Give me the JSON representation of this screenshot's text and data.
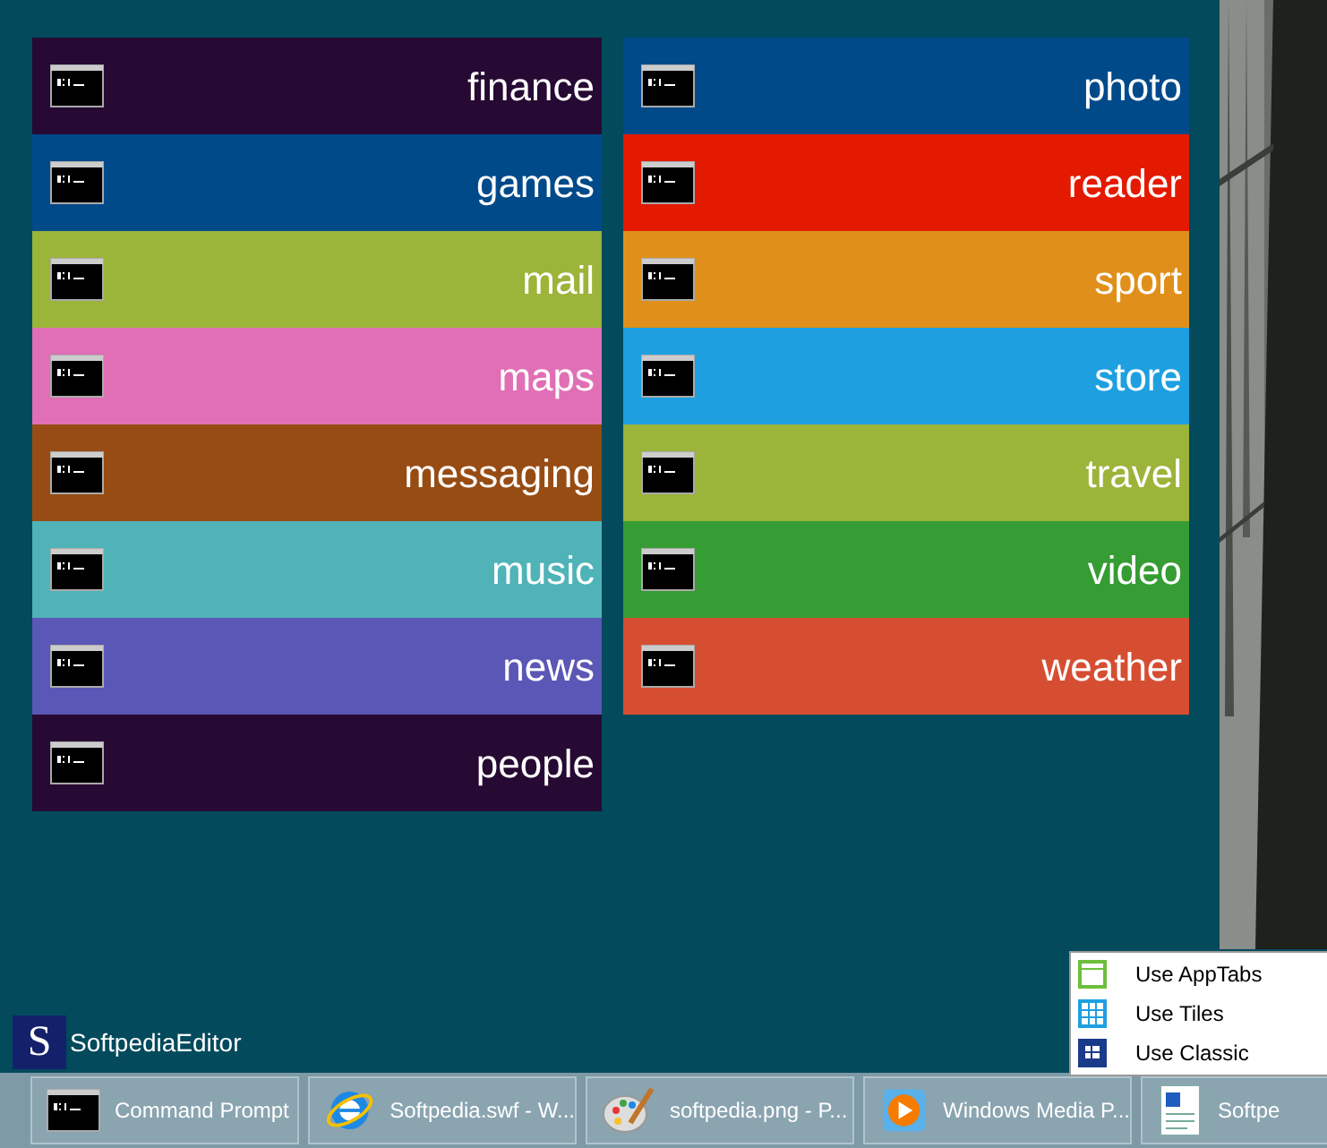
{
  "tiles_left": [
    {
      "label": "finance",
      "color": "#260a33"
    },
    {
      "label": "games",
      "color": "#004a8a"
    },
    {
      "label": "mail",
      "color": "#9bb43a"
    },
    {
      "label": "maps",
      "color": "#e16fb5"
    },
    {
      "label": "messaging",
      "color": "#974c14"
    },
    {
      "label": "music",
      "color": "#4fb3b8"
    },
    {
      "label": "news",
      "color": "#5b57b6"
    },
    {
      "label": "people",
      "color": "#260a33"
    }
  ],
  "tiles_right": [
    {
      "label": "photo",
      "color": "#004a8a"
    },
    {
      "label": "reader",
      "color": "#e41a00"
    },
    {
      "label": "sport",
      "color": "#e0901a"
    },
    {
      "label": "store",
      "color": "#1ea0e0"
    },
    {
      "label": "travel",
      "color": "#9bb43a"
    },
    {
      "label": "video",
      "color": "#369c34"
    },
    {
      "label": "weather",
      "color": "#d64e32"
    }
  ],
  "user": {
    "initial": "S",
    "name": "SoftpediaEditor"
  },
  "context_menu": [
    {
      "label": "Use AppTabs",
      "kind": "apptabs"
    },
    {
      "label": "Use Tiles",
      "kind": "tiles"
    },
    {
      "label": "Use Classic",
      "kind": "classic"
    }
  ],
  "taskbar": [
    {
      "label": "Command Prompt",
      "kind": "console"
    },
    {
      "label": "Softpedia.swf - W...",
      "kind": "browser"
    },
    {
      "label": "softpedia.png - P...",
      "kind": "paint"
    },
    {
      "label": "Windows Media P...",
      "kind": "media"
    },
    {
      "label": "Softpe",
      "kind": "document"
    }
  ]
}
